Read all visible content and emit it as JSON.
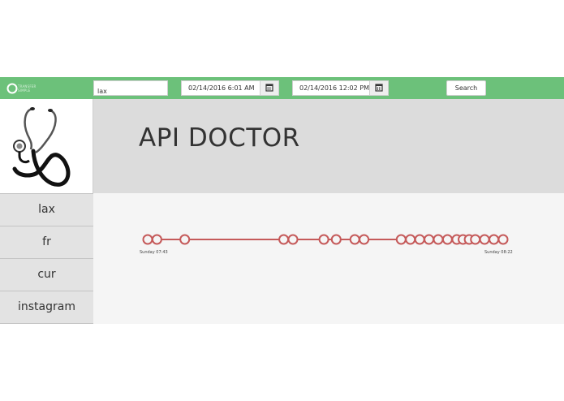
{
  "toolbar": {
    "logo_text": "TRANSFER SIMPLE",
    "search_value": "lax",
    "start_date": "02/14/2016 6:01 AM",
    "end_date": "02/14/2016 12:02 PM",
    "search_label": "Search",
    "accent_color": "#6cc17a"
  },
  "sidebar": {
    "logo_icon": "stethoscope-icon",
    "items": [
      {
        "label": "lax"
      },
      {
        "label": "fr"
      },
      {
        "label": "cur"
      },
      {
        "label": "instagram"
      }
    ]
  },
  "header": {
    "title": "API DOCTOR"
  },
  "timeline": {
    "start_label": "Sunday 07:43",
    "end_label": "Sunday 08:22",
    "color": "#c55a5a",
    "events": [
      0.0,
      0.03,
      0.12,
      0.44,
      0.47,
      0.57,
      0.61,
      0.67,
      0.7,
      0.82,
      0.85,
      0.88,
      0.91,
      0.94,
      0.97,
      1.0,
      1.02,
      1.04,
      1.06,
      1.09,
      1.12,
      1.15
    ]
  }
}
